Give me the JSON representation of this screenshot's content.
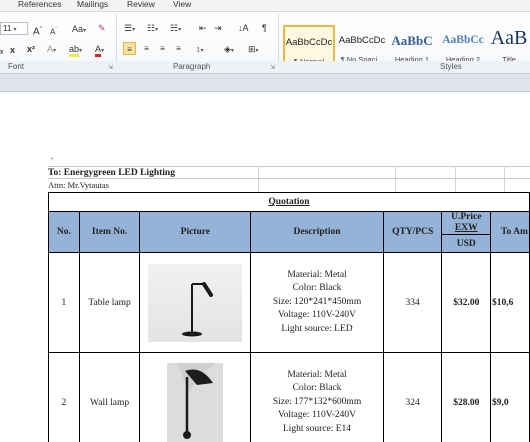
{
  "ribbon": {
    "tabs": [
      "References",
      "Mailings",
      "Review",
      "View"
    ],
    "font_size": "11",
    "groups": {
      "font": "Font",
      "paragraph": "Paragraph",
      "styles": "Styles"
    },
    "styles": [
      {
        "sample": "AaBbCcDc",
        "name": "¶ Normal",
        "selected": true
      },
      {
        "sample": "AaBbCcDc",
        "name": "¶ No Spaci...",
        "selected": false
      },
      {
        "sample": "AaBbC",
        "name": "Heading 1",
        "selected": false
      },
      {
        "sample": "AaBbCc",
        "name": "Heading 2",
        "selected": false
      },
      {
        "sample": "AaB",
        "name": "Title",
        "selected": false
      }
    ]
  },
  "document": {
    "to_line": "To: Energygreen LED Lighting",
    "attn_line": "Attn: Mr.Vytautas",
    "table": {
      "title": "Quotation",
      "headers": {
        "no": "No.",
        "item_no": "Item No.",
        "picture": "Picture",
        "description": "Description",
        "qty": "QTY/PCS",
        "uprice_line1": "U.Price",
        "uprice_line2": "EXW",
        "uprice_line3": "USD",
        "total": "To Am"
      },
      "rows": [
        {
          "no": "1",
          "item": "Table lamp",
          "picture": "table-lamp-photo",
          "desc": [
            "Material: Metal",
            "Color: Black",
            "Size: 120*241*450mm",
            "Voltage: 110V-240V",
            "Light source: LED"
          ],
          "qty": "334",
          "price": "$32.00",
          "total": "$10,6"
        },
        {
          "no": "2",
          "item": "Wall lamp",
          "picture": "wall-lamp-photo",
          "desc": [
            "Material: Metal",
            "Color: Black",
            "Size: 177*132*600mm",
            "Voltage: 110V-240V",
            "Light source: E14"
          ],
          "qty": "324",
          "price": "$28.00",
          "total": "$9,0"
        }
      ]
    }
  },
  "colors": {
    "header_fill": "#95b3d7",
    "selected_style": "#e6b943"
  }
}
